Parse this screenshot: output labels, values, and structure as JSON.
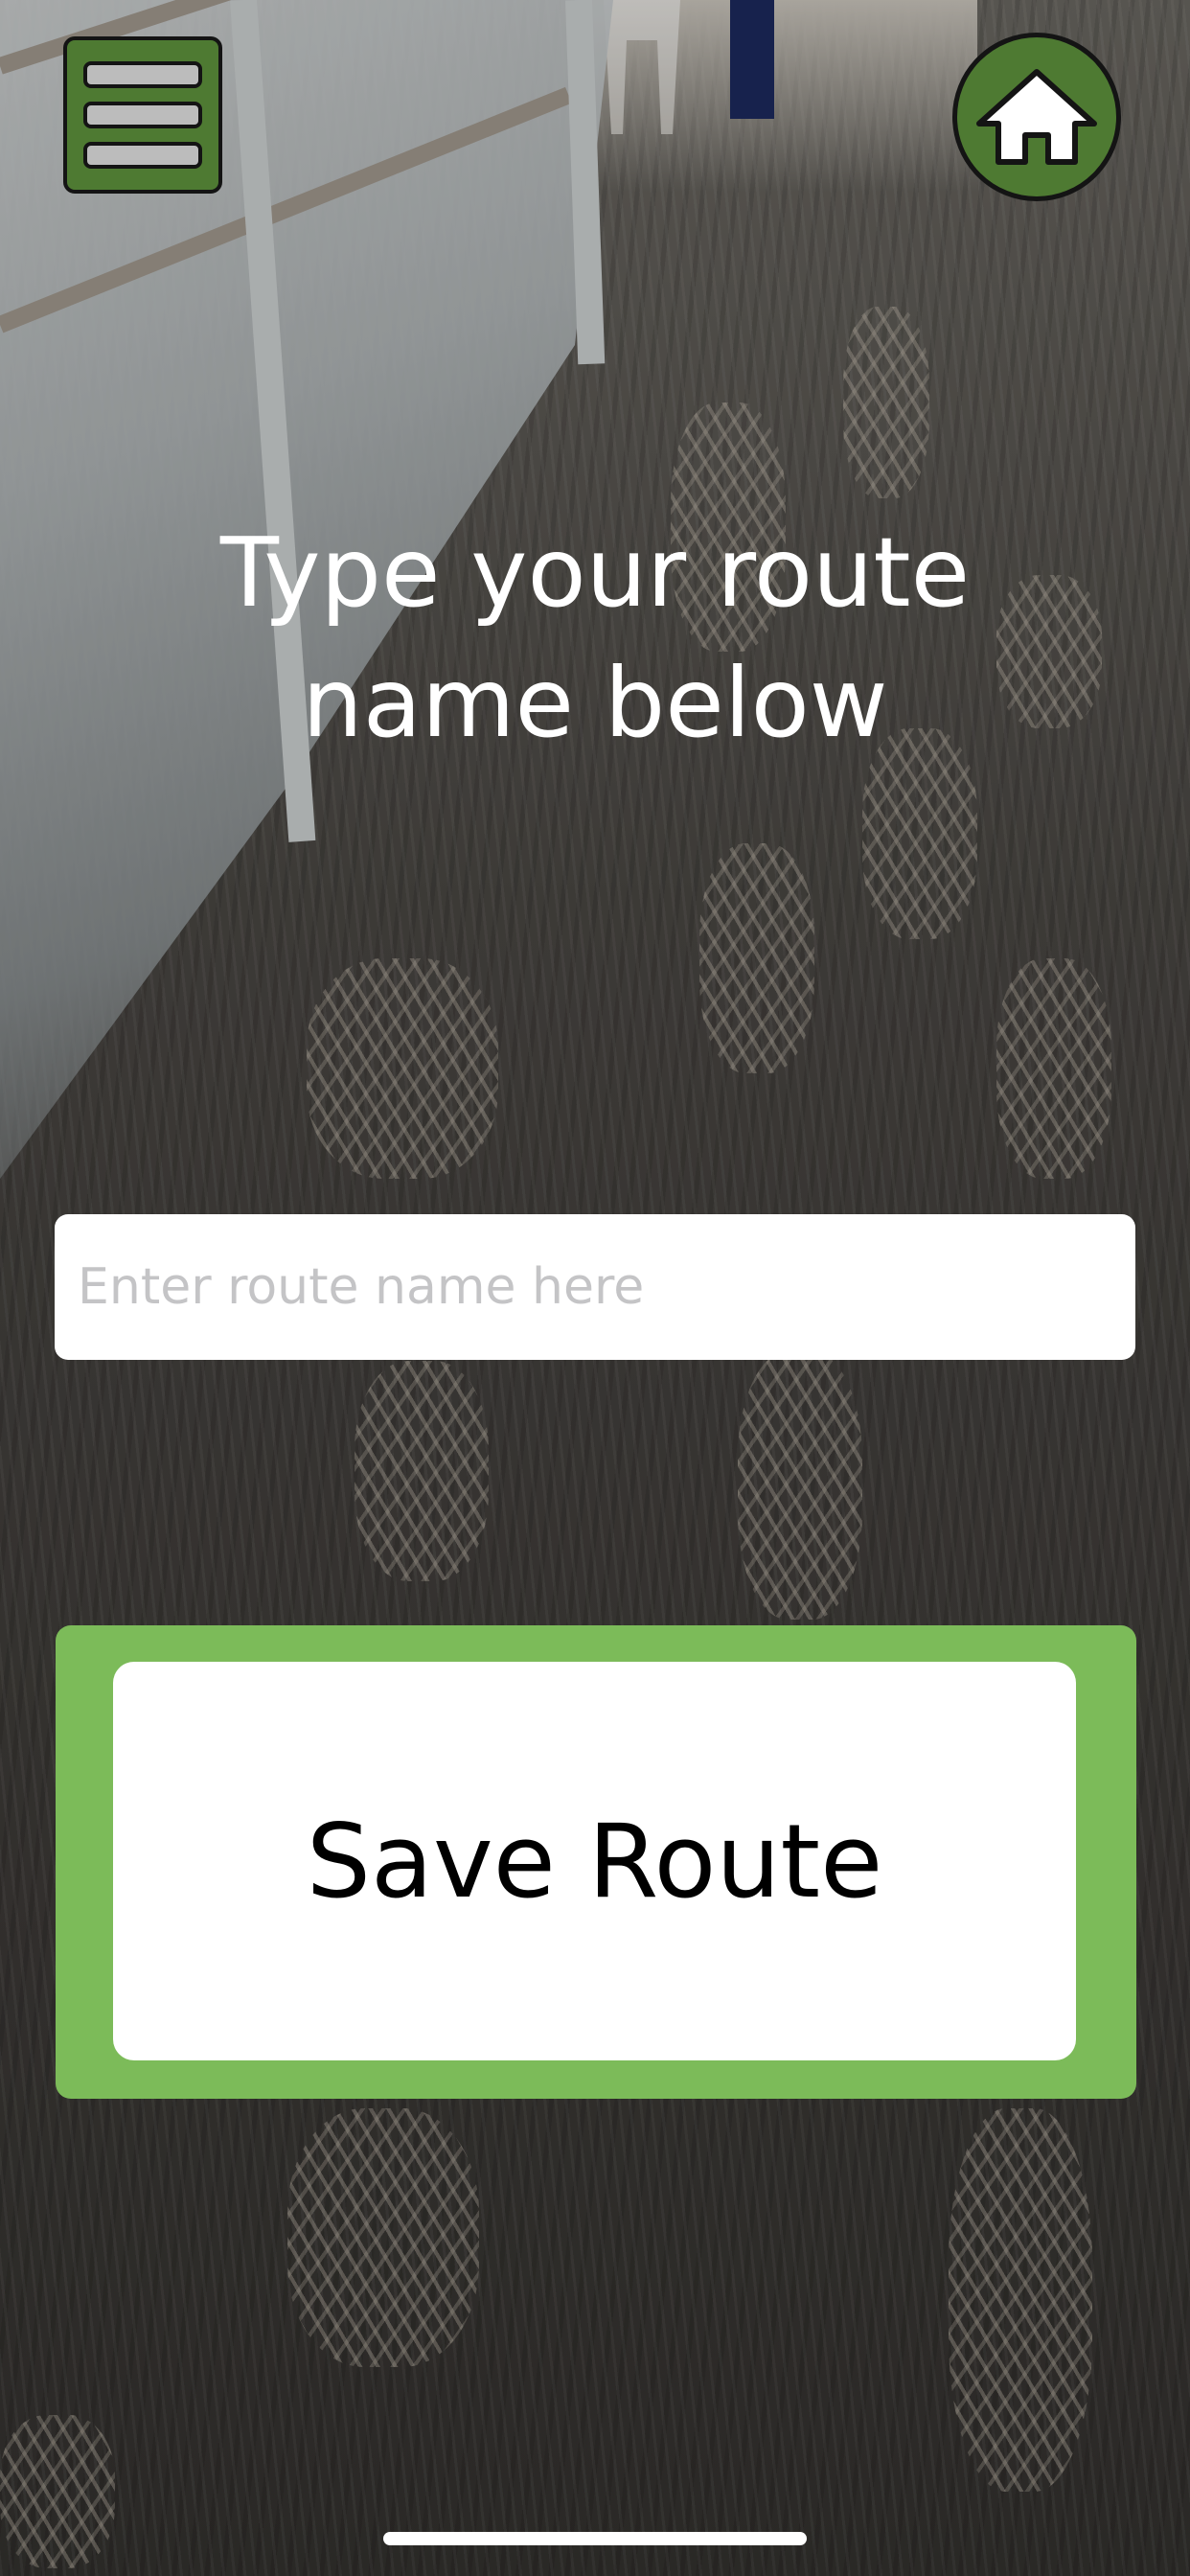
{
  "header": {
    "menu_icon": "hamburger-menu-icon",
    "home_icon": "home-icon",
    "accent_color": "#4e7a32"
  },
  "main": {
    "title": "Type your route\nname below",
    "route_input": {
      "value": "",
      "placeholder": "Enter route name here"
    },
    "save_button_label": "Save Route",
    "save_frame_color": "#7cbb59"
  }
}
